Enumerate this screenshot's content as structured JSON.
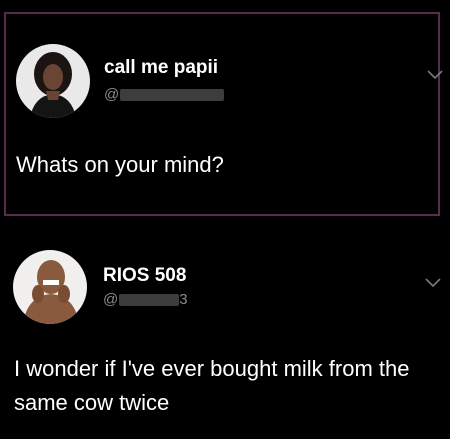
{
  "posts": [
    {
      "display_name": "call me papii",
      "handle_prefix": "@",
      "text": "Whats on your mind?",
      "avatar_icon": "profile-photo-woman",
      "menu_icon": "chevron-down-icon",
      "highlight_color": "#5a2d4e"
    },
    {
      "display_name": "RIOS 508",
      "handle_prefix": "@",
      "handle_suffix": "3",
      "text": "I wonder if I've ever bought milk from the same cow twice",
      "avatar_icon": "profile-photo-man",
      "menu_icon": "chevron-down-icon"
    }
  ]
}
